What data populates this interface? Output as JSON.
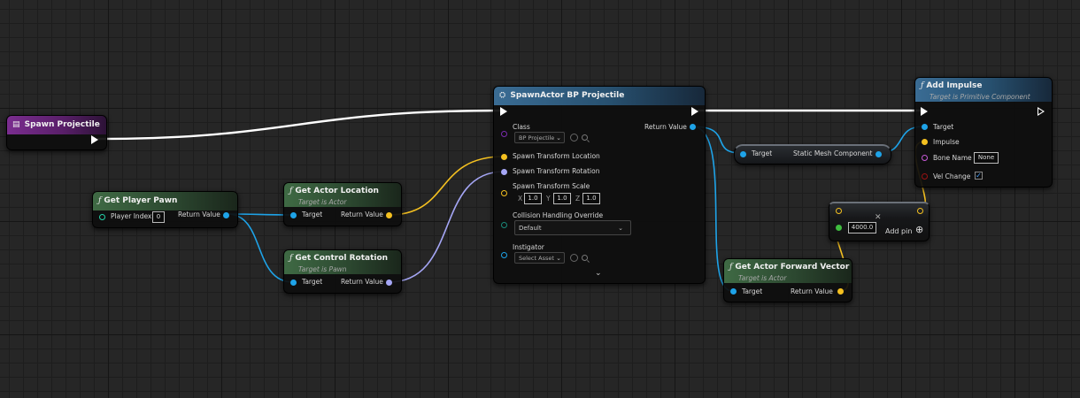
{
  "graph": {
    "spawn_projectile": {
      "title": "Spawn Projectile"
    },
    "get_player_pawn": {
      "title": "Get Player Pawn",
      "player_index_label": "Player Index",
      "player_index_value": "0",
      "return_label": "Return Value"
    },
    "get_actor_location": {
      "title": "Get Actor Location",
      "subtitle": "Target is Actor",
      "target_label": "Target",
      "return_label": "Return Value"
    },
    "get_control_rotation": {
      "title": "Get Control Rotation",
      "subtitle": "Target is Pawn",
      "target_label": "Target",
      "return_label": "Return Value"
    },
    "spawn_actor": {
      "title": "SpawnActor BP Projectile",
      "class_label": "Class",
      "class_value": "BP Projectile",
      "return_label": "Return Value",
      "location_label": "Spawn Transform Location",
      "rotation_label": "Spawn Transform Rotation",
      "scale_label": "Spawn Transform Scale",
      "scale_x_label": "X",
      "scale_x": "1.0",
      "scale_y_label": "Y",
      "scale_y": "1.0",
      "scale_z_label": "Z",
      "scale_z": "1.0",
      "collision_label": "Collision Handling Override",
      "collision_value": "Default",
      "instigator_label": "Instigator",
      "instigator_value": "Select Asset"
    },
    "static_mesh_getter": {
      "target_label": "Target",
      "output_label": "Static Mesh Component"
    },
    "add_impulse": {
      "title": "Add Impulse",
      "subtitle": "Target is Primitive Component",
      "target_label": "Target",
      "impulse_label": "Impulse",
      "bone_label": "Bone Name",
      "bone_value": "None",
      "vel_label": "Vel Change",
      "vel_checked": "✓"
    },
    "multiply": {
      "value": "4000.0",
      "add_pin_label": "Add pin",
      "close_glyph": "✕",
      "plus_glyph": "⊕"
    },
    "forward_vector": {
      "title": "Get Actor Forward Vector",
      "subtitle": "Target is Actor",
      "target_label": "Target",
      "return_label": "Return Value"
    }
  },
  "icons": {
    "function": "ƒ",
    "spawn": "⛭",
    "event": "▤"
  },
  "colors": {
    "exec": "#ffffff",
    "object": "#1ea3e8",
    "vector": "#f4c020",
    "rotator": "#a5a6f5",
    "struct": "#7b2bb0",
    "bool": "#9b1212",
    "float": "#3fbd3f"
  }
}
